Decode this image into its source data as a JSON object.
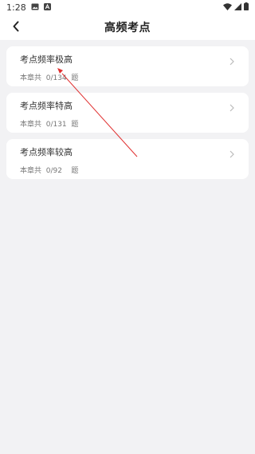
{
  "status": {
    "time": "1:28"
  },
  "header": {
    "title": "高频考点"
  },
  "cards": [
    {
      "title": "考点频率极高",
      "count_text": "本章共  0/134  题"
    },
    {
      "title": "考点频率特高",
      "count_text": "本章共  0/131  题"
    },
    {
      "title": "考点频率较高",
      "count_text": "本章共  0/92    题"
    }
  ],
  "colors": {
    "background": "#f2f2f4",
    "card": "#ffffff",
    "annotation_arrow": "#e03030"
  }
}
